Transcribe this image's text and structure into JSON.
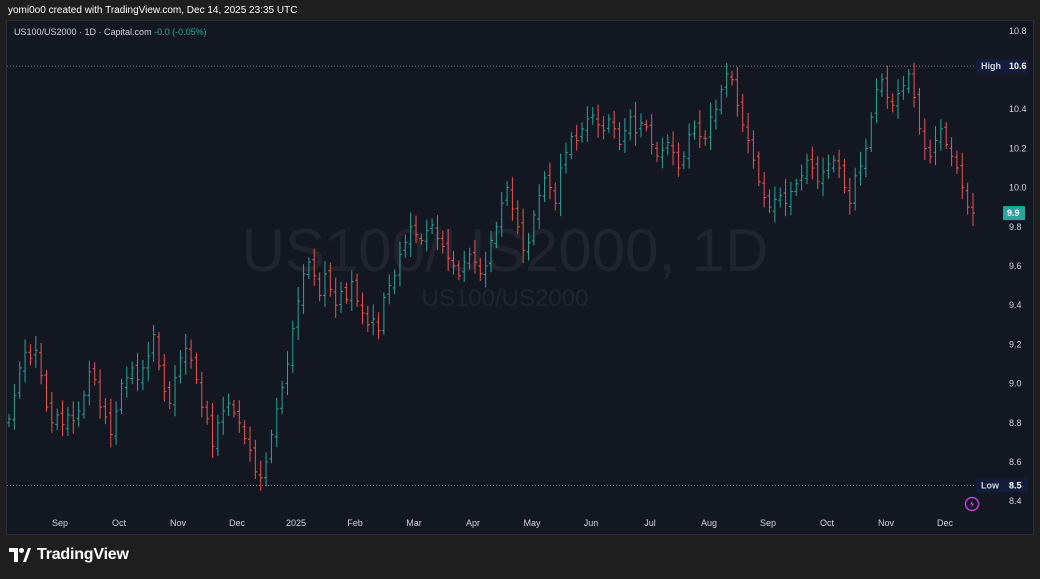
{
  "caption": "yomi0o0 created with TradingView.com, Dec 14, 2025 23:35 UTC",
  "legend": {
    "symbol": "US100/US2000 · 1D · Capital.com",
    "change": "-0.0 (-0.05%)"
  },
  "watermark": {
    "main": "US100/US2000, 1D",
    "sub": "US100/US2000"
  },
  "brand": "TradingView",
  "colors": {
    "background": "#131722",
    "up": "#26a69a",
    "down": "#ef5350",
    "tag": "#131d3b",
    "last_tag": "#26a69a"
  },
  "chart_data": {
    "type": "ohlc",
    "timeframe": "1D",
    "y_range": [
      8.35,
      10.85
    ],
    "y_ticks": [
      {
        "value": 8.4,
        "label": "8.4"
      },
      {
        "value": 8.6,
        "label": "8.6"
      },
      {
        "value": 8.8,
        "label": "8.8"
      },
      {
        "value": 9.0,
        "label": "9.0"
      },
      {
        "value": 9.2,
        "label": "9.2"
      },
      {
        "value": 9.4,
        "label": "9.4"
      },
      {
        "value": 9.6,
        "label": "9.6"
      },
      {
        "value": 9.8,
        "label": "9.8"
      },
      {
        "value": 10.0,
        "label": "10.0"
      },
      {
        "value": 10.2,
        "label": "10.2"
      },
      {
        "value": 10.4,
        "label": "10.4"
      },
      {
        "value": 10.8,
        "label": "10.8"
      }
    ],
    "x_labels": [
      "Sep",
      "Oct",
      "Nov",
      "Dec",
      "2025",
      "Feb",
      "Mar",
      "Apr",
      "May",
      "Jun",
      "Jul",
      "Aug",
      "Sep",
      "Oct",
      "Nov",
      "Dec"
    ],
    "high": {
      "label": "High",
      "value_text": "10.6",
      "value": 10.62
    },
    "low": {
      "label": "Low",
      "value_text": "8.5",
      "value": 8.48
    },
    "last": {
      "value_text": "9.9",
      "value": 9.87
    },
    "series": [
      {
        "values": [
          8.82,
          8.94,
          9.08,
          9.16,
          9.13,
          9.17,
          9.04,
          8.88,
          8.8,
          8.84,
          8.79,
          8.84,
          8.81,
          8.86,
          8.94,
          9.06,
          9.02,
          8.88,
          8.83,
          8.74,
          8.86,
          9.0,
          9.03,
          9.08,
          9.02,
          9.08,
          9.14,
          9.25,
          9.09,
          8.96,
          8.9,
          9.03,
          9.13,
          9.18,
          9.12,
          9.02,
          8.88,
          8.82,
          8.68,
          8.8,
          8.86,
          8.9,
          8.85,
          8.8,
          8.72,
          8.66,
          8.55,
          8.52,
          8.6,
          8.74,
          8.87,
          8.98,
          9.1,
          9.28,
          9.42,
          9.56,
          9.62,
          9.55,
          9.45,
          9.56,
          9.48,
          9.4,
          9.47,
          9.43,
          9.52,
          9.42,
          9.36,
          9.3,
          9.33,
          9.27,
          9.44,
          9.5,
          9.55,
          9.66,
          9.72,
          9.8,
          9.76,
          9.73,
          9.78,
          9.81,
          9.74,
          9.7,
          9.64,
          9.6,
          9.55,
          9.62,
          9.66,
          9.62,
          9.56,
          9.6,
          9.73,
          9.8,
          9.92,
          10.0,
          9.89,
          9.8,
          9.68,
          9.72,
          9.86,
          9.96,
          10.05,
          10.0,
          9.92,
          10.1,
          10.18,
          10.26,
          10.24,
          10.3,
          10.35,
          10.37,
          10.32,
          10.29,
          10.35,
          10.3,
          10.22,
          10.29,
          10.36,
          10.28,
          10.33,
          10.31,
          10.22,
          10.16,
          10.19,
          10.23,
          10.18,
          10.1,
          10.16,
          10.27,
          10.31,
          10.26,
          10.25,
          10.36,
          10.4,
          10.5,
          10.58,
          10.55,
          10.42,
          10.32,
          10.24,
          10.14,
          10.03,
          9.95,
          9.9,
          9.94,
          9.96,
          9.92,
          9.98,
          10.02,
          10.06,
          10.14,
          10.1,
          10.03,
          10.08,
          10.12,
          10.14,
          10.1,
          10.0,
          9.92,
          10.06,
          10.11,
          10.2,
          10.36,
          10.5,
          10.55,
          10.46,
          10.42,
          10.48,
          10.52,
          10.58,
          10.46,
          10.3,
          10.2,
          10.16,
          10.24,
          10.3,
          10.22,
          10.16,
          10.1,
          10.0,
          9.9,
          9.87
        ]
      }
    ]
  }
}
